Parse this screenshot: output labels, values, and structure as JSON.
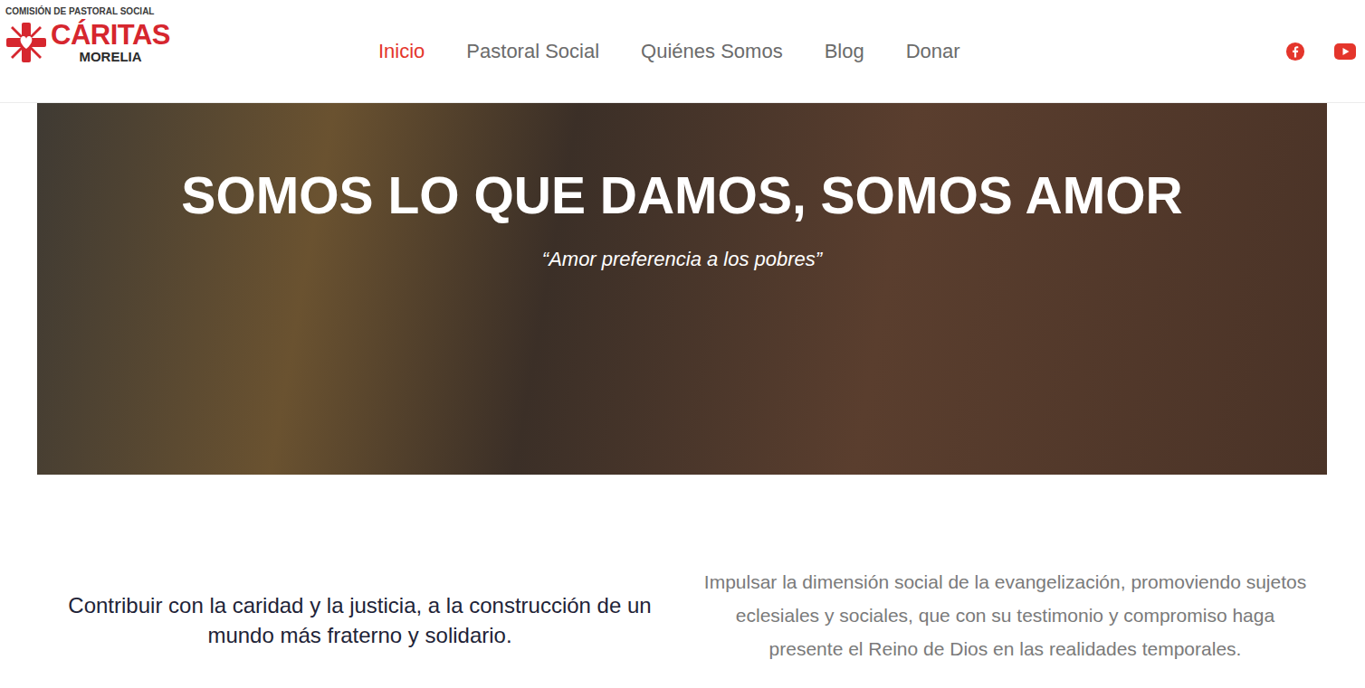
{
  "header": {
    "logo": {
      "top": "COMISIÓN DE PASTORAL SOCIAL",
      "name": "CÁRITAS",
      "city": "MORELIA"
    },
    "nav": [
      {
        "label": "Inicio",
        "selected": true
      },
      {
        "label": "Pastoral Social",
        "selected": false
      },
      {
        "label": "Quiénes Somos",
        "selected": false
      },
      {
        "label": "Blog",
        "selected": false
      },
      {
        "label": "Donar",
        "selected": false
      }
    ]
  },
  "hero": {
    "title": "SOMOS LO QUE DAMOS, SOMOS AMOR",
    "subtitle": "“Amor preferencia a los pobres”"
  },
  "mission": "Contribuir con la caridad y la justicia, a la construcción de un mundo más fraterno y solidario.",
  "vision": "Impulsar la dimensión social de la evangelización, promoviendo sujetos eclesiales y sociales, que con su testimonio y compromiso haga presente el Reino de Dios en las realidades temporales."
}
